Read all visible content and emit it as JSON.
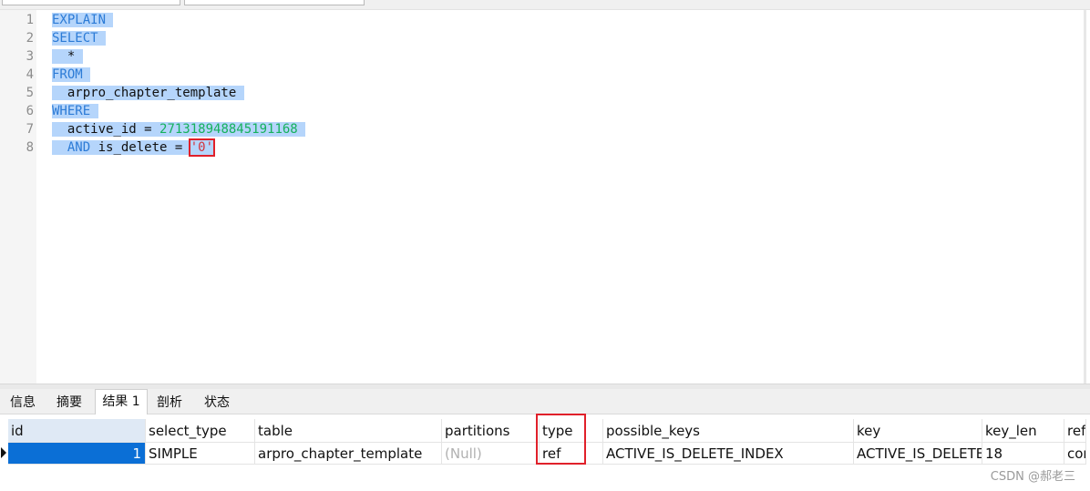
{
  "editor": {
    "line_numbers": [
      "1",
      "2",
      "3",
      "4",
      "5",
      "6",
      "7",
      "8"
    ],
    "lines": {
      "l1": "EXPLAIN",
      "l2": "SELECT",
      "l3": "  *",
      "l4": "FROM",
      "l5": "  arpro_chapter_template",
      "l6": "WHERE",
      "l7_ident": "  active_id = ",
      "l7_num": "271318948845191168",
      "l8_kw": "  AND",
      "l8_ident": " is_delete = ",
      "l8_str": "'0'"
    },
    "colors": {
      "keyword": "#2c7bd6",
      "number": "#16b15c",
      "string": "#d4343c",
      "selection": "#b5d5fb",
      "highlight_box": "#e0202a"
    }
  },
  "tabs": [
    "信息",
    "摘要",
    "结果 1",
    "剖析",
    "状态"
  ],
  "active_tab": "结果 1",
  "results": {
    "columns": [
      "id",
      "select_type",
      "table",
      "partitions",
      "type",
      "possible_keys",
      "key",
      "key_len",
      "ref"
    ],
    "rows": [
      [
        "1",
        "SIMPLE",
        "arpro_chapter_template",
        "(Null)",
        "ref",
        "ACTIVE_IS_DELETE_INDEX",
        "ACTIVE_IS_DELETE_",
        "18",
        "cor"
      ]
    ]
  },
  "watermark": "CSDN @郝老三"
}
